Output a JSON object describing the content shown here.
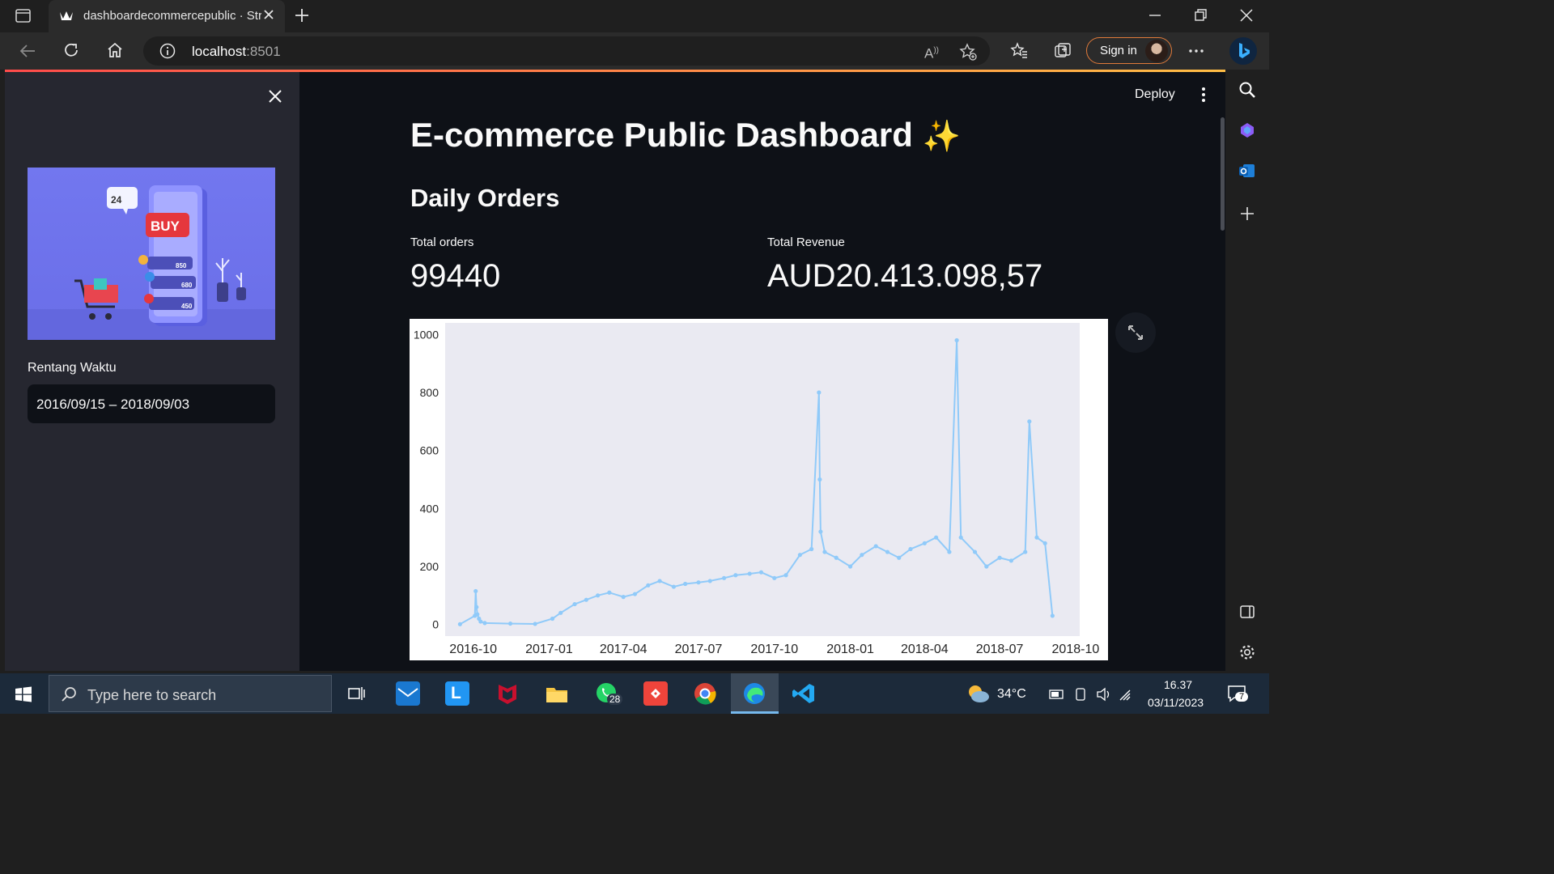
{
  "browser": {
    "tab_title": "dashboardecommercepublic · Streamlit",
    "url_host": "localhost",
    "url_port": ":8501",
    "signin_label": "Sign in"
  },
  "app": {
    "deploy_label": "Deploy",
    "title": "E-commerce Public Dashboard",
    "title_emoji": "✨",
    "subheader": "Daily Orders",
    "metrics": [
      {
        "label": "Total orders",
        "value": "99440"
      },
      {
        "label": "Total Revenue",
        "value": "AUD20.413.098,57"
      }
    ]
  },
  "sidebar": {
    "banner": {
      "chat_text": "24",
      "buy_text": "BUY",
      "prices": [
        "850",
        "680",
        "450"
      ]
    },
    "date_label": "Rentang Waktu",
    "date_value": "2016/09/15 – 2018/09/03"
  },
  "chart_data": {
    "type": "line",
    "x_tick_labels": [
      "2016-10",
      "2017-01",
      "2017-04",
      "2017-07",
      "2017-10",
      "2018-01",
      "2018-04",
      "2018-07",
      "2018-10"
    ],
    "y_tick_labels": [
      "0",
      "200",
      "400",
      "600",
      "800",
      "1000"
    ],
    "ylim": [
      -40,
      1040
    ],
    "xlim": [
      "2016-08-28",
      "2018-10-06"
    ],
    "grid": false,
    "color": "#90CAF9",
    "x": [
      "2016-09-15",
      "2016-10-03",
      "2016-10-04",
      "2016-10-05",
      "2016-10-06",
      "2016-10-08",
      "2016-10-10",
      "2016-10-15",
      "2016-11-15",
      "2016-12-15",
      "2017-01-05",
      "2017-01-15",
      "2017-02-01",
      "2017-02-15",
      "2017-03-01",
      "2017-03-15",
      "2017-04-01",
      "2017-04-15",
      "2017-05-01",
      "2017-05-15",
      "2017-06-01",
      "2017-06-15",
      "2017-07-01",
      "2017-07-15",
      "2017-08-01",
      "2017-08-15",
      "2017-09-01",
      "2017-09-15",
      "2017-10-01",
      "2017-10-15",
      "2017-11-01",
      "2017-11-15",
      "2017-11-24",
      "2017-11-25",
      "2017-11-26",
      "2017-12-01",
      "2017-12-15",
      "2018-01-01",
      "2018-01-15",
      "2018-02-01",
      "2018-02-15",
      "2018-03-01",
      "2018-03-15",
      "2018-04-01",
      "2018-04-15",
      "2018-05-01",
      "2018-05-10",
      "2018-05-15",
      "2018-06-01",
      "2018-06-15",
      "2018-07-01",
      "2018-07-15",
      "2018-08-01",
      "2018-08-06",
      "2018-08-15",
      "2018-08-25",
      "2018-09-03"
    ],
    "values": [
      1,
      30,
      115,
      60,
      35,
      20,
      10,
      5,
      3,
      2,
      20,
      40,
      70,
      85,
      100,
      110,
      95,
      105,
      135,
      150,
      130,
      140,
      145,
      150,
      160,
      170,
      175,
      180,
      160,
      170,
      240,
      260,
      800,
      500,
      320,
      250,
      230,
      200,
      240,
      270,
      250,
      230,
      260,
      280,
      300,
      250,
      980,
      300,
      250,
      200,
      230,
      220,
      250,
      700,
      300,
      280,
      30
    ]
  },
  "taskbar": {
    "search_placeholder": "Type here to search",
    "temperature": "34°C",
    "time": "16.37",
    "date": "03/11/2023",
    "whatsapp_badge": "28",
    "notif_badge": "7"
  }
}
